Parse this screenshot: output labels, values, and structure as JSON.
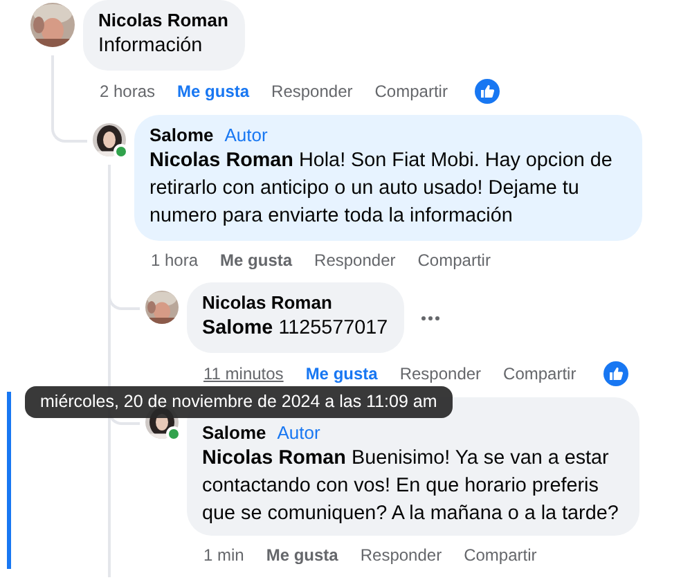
{
  "comments": [
    {
      "author": "Nicolas Roman",
      "online": false,
      "text": "Información",
      "time": "2 horas",
      "time_hovered": false,
      "like": "Me gusta",
      "liked": true,
      "reply": "Responder",
      "share": "Compartir",
      "has_reaction": true,
      "show_more": false,
      "highlighted": false,
      "children": [
        {
          "author": "Salome",
          "online": true,
          "author_badge": "Autor",
          "text": "**Nicolas Roman** Hola! Son Fiat Mobi. Hay opcion de retirarlo con anticipo o un auto usado! Dejame tu numero para enviarte toda la información",
          "time": "1 hora",
          "time_hovered": false,
          "like": "Me gusta",
          "liked": false,
          "reply": "Responder",
          "share": "Compartir",
          "has_reaction": false,
          "show_more": false,
          "highlighted": false,
          "children": [
            {
              "author": "Nicolas Roman",
              "online": false,
              "text": "**Salome** 1125577017",
              "time": "11 minutos",
              "time_hovered": true,
              "like": "Me gusta",
              "liked": true,
              "reply": "Responder",
              "share": "Compartir",
              "has_reaction": true,
              "show_more": true,
              "highlighted": false
            },
            {
              "author": "Salome",
              "online": true,
              "author_badge": "Autor",
              "text": "**Nicolas Roman** Buenisimo! Ya se van a estar contactando con vos! En que horario preferis que se comuniquen? A la mañana o a la tarde?",
              "time": "1 min",
              "time_hovered": false,
              "like": "Me gusta",
              "liked": false,
              "reply": "Responder",
              "share": "Compartir",
              "has_reaction": false,
              "show_more": false,
              "highlighted": true
            }
          ]
        }
      ]
    }
  ],
  "tooltip": {
    "text": "miércoles, 20 de noviembre de 2024 a las 11:09 am"
  }
}
